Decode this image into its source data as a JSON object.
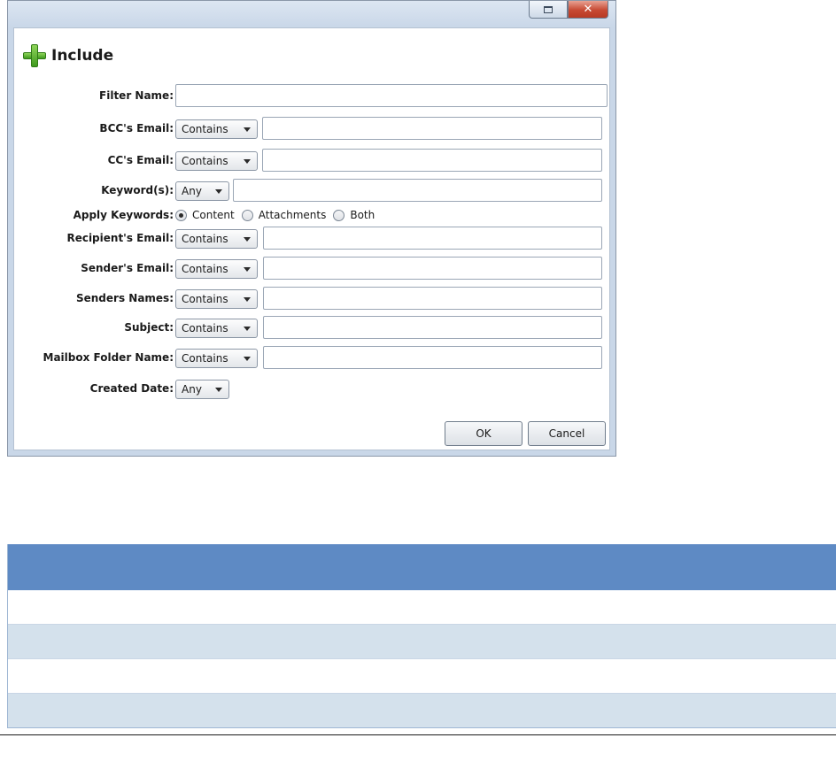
{
  "dialog": {
    "title": "Include",
    "restore_button_icon": "restore-icon",
    "close_button_glyph": "✕",
    "fields": {
      "filter_name": {
        "label": "Filter Name:",
        "value": ""
      },
      "bcc_email": {
        "label": "BCC's Email:",
        "operator": "Contains",
        "value": ""
      },
      "cc_email": {
        "label": "CC's Email:",
        "operator": "Contains",
        "value": ""
      },
      "keywords": {
        "label": "Keyword(s):",
        "operator": "Any",
        "value": ""
      },
      "apply_keywords": {
        "label": "Apply Keywords:",
        "options": [
          "Content",
          "Attachments",
          "Both"
        ],
        "selected": "Content"
      },
      "recipient_email": {
        "label": "Recipient's Email:",
        "operator": "Contains",
        "value": ""
      },
      "sender_email": {
        "label": "Sender's Email:",
        "operator": "Contains",
        "value": ""
      },
      "senders_names": {
        "label": "Senders Names:",
        "operator": "Contains",
        "value": ""
      },
      "subject": {
        "label": "Subject:",
        "operator": "Contains",
        "value": ""
      },
      "mailbox_folder_name": {
        "label": "Mailbox Folder Name:",
        "operator": "Contains",
        "value": ""
      },
      "created_date": {
        "label": "Created Date:",
        "operator": "Any"
      }
    },
    "buttons": {
      "ok": "OK",
      "cancel": "Cancel"
    }
  },
  "table": {
    "header_color": "#5e8ac4",
    "alt_row_color": "#d4e1ec",
    "rows": [
      "",
      "",
      "",
      ""
    ]
  }
}
